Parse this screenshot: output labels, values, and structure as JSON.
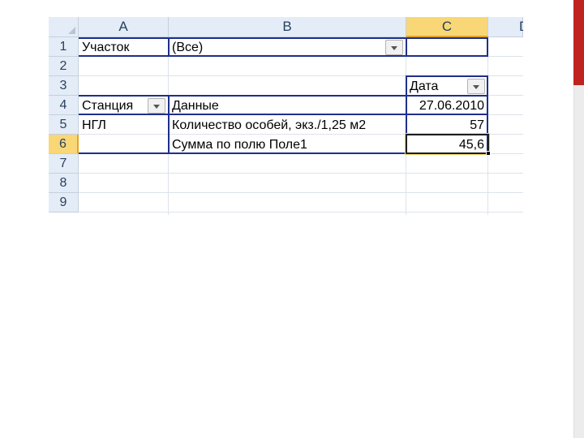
{
  "columns": [
    "A",
    "B",
    "C",
    "D"
  ],
  "rows": [
    "1",
    "2",
    "3",
    "4",
    "5",
    "6",
    "7",
    "8",
    "9"
  ],
  "pivot": {
    "filter_label": "Участок",
    "filter_value": "(Все)",
    "col_field": "Дата",
    "row_field": "Станция",
    "data_field": "Данные",
    "date_value": "27.06.2010",
    "station": "НГЛ",
    "measure1_label": "Количество особей, экз./1,25 м2",
    "measure1_value": "57",
    "measure2_label": "Сумма по полю Поле1",
    "measure2_value": "45,6"
  },
  "colors": {
    "accent_red": "#c0231f",
    "pivot_border": "#1f2f8c",
    "selected_header": "#f9d776"
  },
  "active_cell": "C6"
}
